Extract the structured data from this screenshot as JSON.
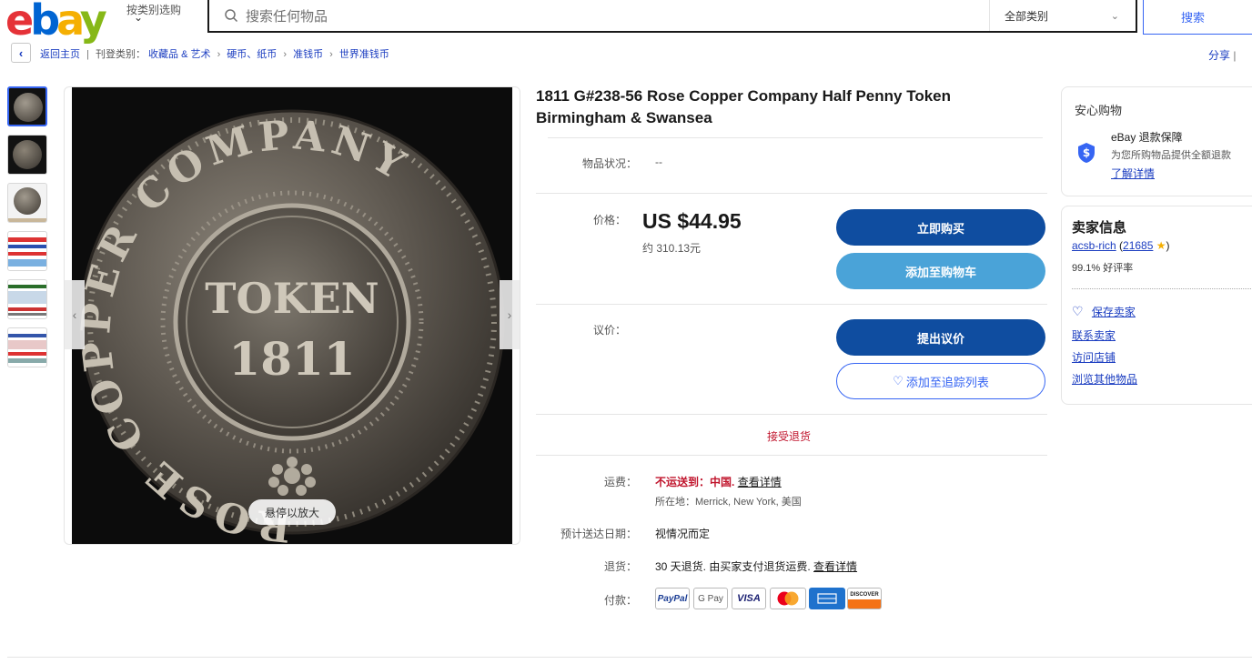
{
  "header": {
    "logo_letters": [
      "e",
      "b",
      "a",
      "y"
    ],
    "shop_by_category": "按类别选购",
    "search_placeholder": "搜索任何物品",
    "category_select": "全部类别",
    "search_button": "搜索"
  },
  "breadcrumb": {
    "back_home": "返回主页",
    "listed_in": "刊登类别：",
    "items": [
      "收藏品 & 艺术",
      "硬币、纸币",
      "准钱币",
      "世界准钱币"
    ],
    "share": "分享",
    "share_extra": "|"
  },
  "gallery": {
    "zoom_hint": "悬停以放大",
    "thumbnail_count": 6
  },
  "item": {
    "title": "1811 G#238-56 Rose Copper Company Half Penny Token Birmingham & Swansea",
    "condition_label": "物品状况：",
    "condition_value": "--",
    "price_label": "价格：",
    "price": "US $44.95",
    "price_approx": "约 310.13元",
    "buy_now": "立即购买",
    "add_to_cart": "添加至购物车",
    "offer_label": "议价：",
    "make_offer": "提出议价",
    "add_watchlist": "添加至追踪列表",
    "returns_accepted": "接受退货"
  },
  "shipping": {
    "shipping_label": "运费：",
    "no_ship_prefix": "不运送到：",
    "no_ship_country": "中国.",
    "see_details": "查看详情",
    "location": "所在地：Merrick, New York, 美国",
    "delivery_label": "预计送达日期：",
    "delivery_value": "视情况而定",
    "returns_label": "退货：",
    "returns_value": "30 天退货. 由买家支付退货运费.",
    "returns_details": "查看详情",
    "payment_label": "付款：",
    "payment_methods": [
      "PayPal",
      "G Pay",
      "VISA",
      "Mastercard",
      "American Express",
      "DISCOVER"
    ]
  },
  "shop_safe": {
    "title": "安心购物",
    "guarantee_title": "eBay 退款保障",
    "guarantee_desc": "为您所购物品提供全额退款",
    "learn_more": "了解详情"
  },
  "seller": {
    "title": "卖家信息",
    "name": "acsb-rich",
    "feedback_count": "21685",
    "positive": "99.1% 好评率",
    "save_seller": "保存卖家",
    "contact": "联系卖家",
    "visit_store": "访问店铺",
    "other_items": "浏览其他物品"
  },
  "coin_image": {
    "outer_text": "ROSE COPPER COMPANY",
    "token_text": "TOKEN",
    "year": "1811"
  },
  "colors": {
    "primary_blue": "#0f4da0",
    "light_blue": "#4aa3d8",
    "link_blue": "#1a3cc0",
    "accent_red": "#c0142c"
  }
}
